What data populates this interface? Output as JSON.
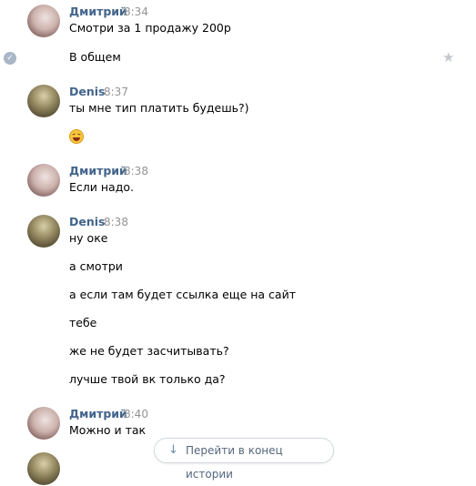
{
  "messages": [
    {
      "author": "Дмитрий",
      "time": "8:34",
      "avatar": "dmitry-avatar",
      "lines": [
        "Смотри за 1 продажу 200р",
        "В общем"
      ]
    },
    {
      "author": "Denis",
      "time": "8:37",
      "avatar": "denis-avatar",
      "lines": [
        "ты мне тип платить будешь?)"
      ],
      "emoji": "grinning-squint-emoji"
    },
    {
      "author": "Дмитрий",
      "time": "8:38",
      "avatar": "dmitry-avatar",
      "lines": [
        "Если надо."
      ]
    },
    {
      "author": "Denis",
      "time": "8:38",
      "avatar": "denis-avatar",
      "lines": [
        "ну оке",
        "а смотри",
        "а если там будет ссылка еще на сайт",
        "тебе",
        "же не будет засчитывать?",
        "лучше твой вк только да?"
      ]
    },
    {
      "author": "Дмитрий",
      "time": "8:40",
      "avatar": "dmitry-avatar",
      "lines": [
        "Можно и так"
      ]
    }
  ],
  "scroll_button": {
    "label": "Перейти в конец истории",
    "icon": "arrow-down-icon"
  },
  "icons": {
    "selected": "check-circle-icon",
    "favorite": "star-icon"
  },
  "colors": {
    "author": "#42648b",
    "time": "#939393",
    "button_text": "#55677d"
  }
}
